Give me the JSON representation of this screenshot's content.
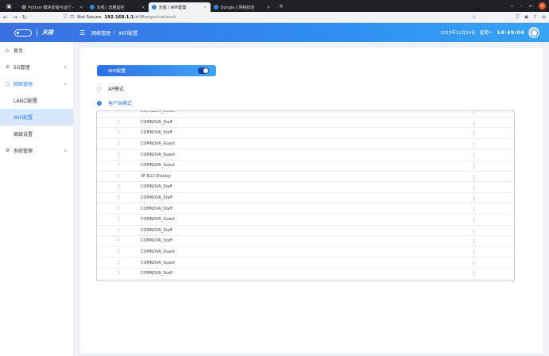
{
  "browser": {
    "tabs": [
      {
        "title": "Python 模块安装与运行 -",
        "active": false
      },
      {
        "title": "天视 | 流量监控",
        "active": false
      },
      {
        "title": "天视 | WiFi配置",
        "active": true
      },
      {
        "title": "Dongle | 网络状态",
        "active": false
      }
    ],
    "new_tab": "+",
    "security_label": "Not Secure",
    "url_host": "192.168.1.1",
    "url_path": "/#/Manger/network"
  },
  "header": {
    "logo_text": "天视",
    "breadcrumb": [
      "网络管理",
      "WiFi配置"
    ],
    "breadcrumb_sep": "/",
    "date": "2025年11月24日",
    "weekday": "星期一",
    "time": "14:49:04"
  },
  "sidebar": {
    "items": [
      {
        "label": "首页",
        "icon": "home-icon"
      },
      {
        "label": "5G管理",
        "icon": "signal-icon",
        "chevron": "∨"
      },
      {
        "label": "网络管理",
        "icon": "network-icon",
        "chevron": "∧",
        "open": true
      },
      {
        "label": "系统管理",
        "icon": "gear-icon",
        "chevron": "∨"
      }
    ],
    "sub_items": [
      {
        "label": "LAN口配置"
      },
      {
        "label": "WiFi配置",
        "active": true
      },
      {
        "label": "高级设置"
      }
    ]
  },
  "content": {
    "wifi_label": "WiFi配置",
    "wifi_enabled": true,
    "modes": [
      {
        "label": "AP模式",
        "checked": false
      },
      {
        "label": "客户端模式",
        "checked": true
      }
    ],
    "networks": [
      "COMNOVA_Guest",
      "COMNOVA_Staff",
      "COMNOVA_Staff",
      "COMNOVA_Guest",
      "COMNOVA_Guest",
      "COMNOVA_Guest",
      "3F-R11-Display",
      "COMNOVA_Staff",
      "COMNOVA_Staff",
      "COMNOVA_Staff",
      "COMNOVA_Guest",
      "COMNOVA_Staff",
      "COMNOVA_Staff",
      "COMNOVA_Guest",
      "COMNOVA_Guest",
      "COMNOVA_Staff"
    ]
  },
  "colors": {
    "accent": "#2f7cf6",
    "header_start": "#3a6fe0",
    "header_end": "#38a3f5",
    "active_bg": "#d7e7fd"
  }
}
